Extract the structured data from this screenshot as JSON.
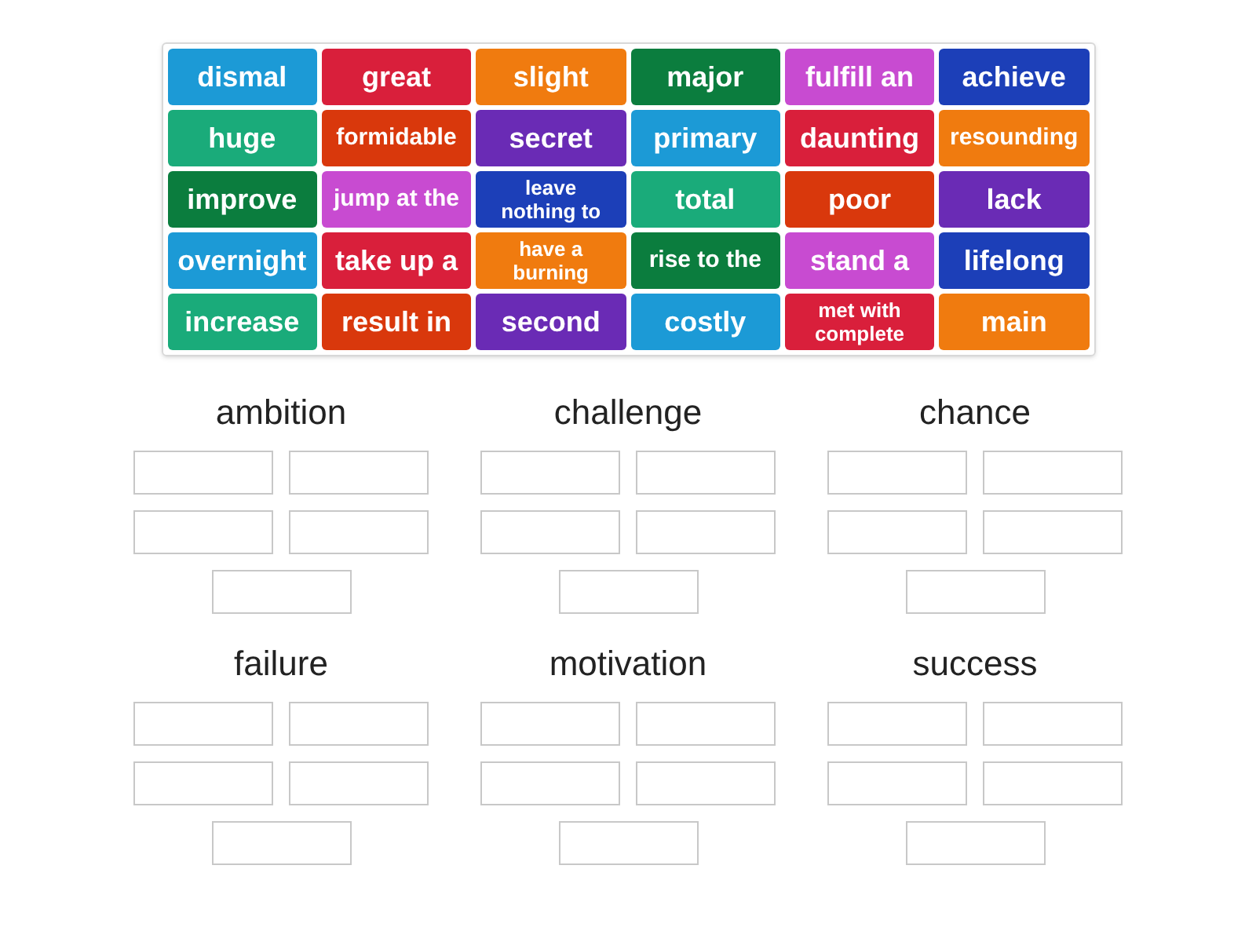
{
  "tiles": [
    {
      "label": "dismal",
      "color": "#1c9ad6",
      "kind": "normal"
    },
    {
      "label": "great",
      "color": "#d91f3b",
      "kind": "normal"
    },
    {
      "label": "slight",
      "color": "#f07b0f",
      "kind": "normal"
    },
    {
      "label": "major",
      "color": "#0b7d3e",
      "kind": "normal"
    },
    {
      "label": "fulfill an",
      "color": "#c84bd1",
      "kind": "normal"
    },
    {
      "label": "achieve",
      "color": "#1c3fb8",
      "kind": "normal"
    },
    {
      "label": "huge",
      "color": "#1aab7a",
      "kind": "normal"
    },
    {
      "label": "formidable",
      "color": "#d9380c",
      "kind": "small"
    },
    {
      "label": "secret",
      "color": "#6a2bb5",
      "kind": "normal"
    },
    {
      "label": "primary",
      "color": "#1c9ad6",
      "kind": "normal"
    },
    {
      "label": "daunting",
      "color": "#d91f3b",
      "kind": "normal"
    },
    {
      "label": "resounding",
      "color": "#f07b0f",
      "kind": "small"
    },
    {
      "label": "improve",
      "color": "#0b7d3e",
      "kind": "normal"
    },
    {
      "label": "jump at the",
      "color": "#c84bd1",
      "kind": "small"
    },
    {
      "label": "leave nothing to",
      "color": "#1c3fb8",
      "kind": "two-line"
    },
    {
      "label": "total",
      "color": "#1aab7a",
      "kind": "normal"
    },
    {
      "label": "poor",
      "color": "#d9380c",
      "kind": "normal"
    },
    {
      "label": "lack",
      "color": "#6a2bb5",
      "kind": "normal"
    },
    {
      "label": "overnight",
      "color": "#1c9ad6",
      "kind": "normal"
    },
    {
      "label": "take up a",
      "color": "#d91f3b",
      "kind": "normal"
    },
    {
      "label": "have a burning",
      "color": "#f07b0f",
      "kind": "two-line"
    },
    {
      "label": "rise to the",
      "color": "#0b7d3e",
      "kind": "small"
    },
    {
      "label": "stand a",
      "color": "#c84bd1",
      "kind": "normal"
    },
    {
      "label": "lifelong",
      "color": "#1c3fb8",
      "kind": "normal"
    },
    {
      "label": "increase",
      "color": "#1aab7a",
      "kind": "normal"
    },
    {
      "label": "result in",
      "color": "#d9380c",
      "kind": "normal"
    },
    {
      "label": "second",
      "color": "#6a2bb5",
      "kind": "normal"
    },
    {
      "label": "costly",
      "color": "#1c9ad6",
      "kind": "normal"
    },
    {
      "label": "met with complete",
      "color": "#d91f3b",
      "kind": "two-line"
    },
    {
      "label": "main",
      "color": "#f07b0f",
      "kind": "normal"
    }
  ],
  "groups": [
    {
      "title": "ambition"
    },
    {
      "title": "challenge"
    },
    {
      "title": "chance"
    },
    {
      "title": "failure"
    },
    {
      "title": "motivation"
    },
    {
      "title": "success"
    }
  ]
}
